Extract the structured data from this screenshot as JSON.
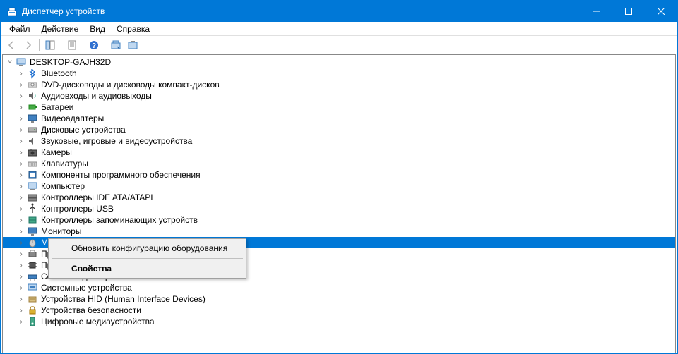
{
  "window": {
    "title": "Диспетчер устройств"
  },
  "menu": {
    "file": "Файл",
    "action": "Действие",
    "view": "Вид",
    "help": "Справка"
  },
  "tree": {
    "root": "DESKTOP-GAJH32D",
    "items": [
      "Bluetooth",
      "DVD-дисководы и дисководы компакт-дисков",
      "Аудиовходы и аудиовыходы",
      "Батареи",
      "Видеоадаптеры",
      "Дисковые устройства",
      "Звуковые, игровые и видеоустройства",
      "Камеры",
      "Клавиатуры",
      "Компоненты программного обеспечения",
      "Компьютер",
      "Контроллеры IDE ATA/ATAPI",
      "Контроллеры USB",
      "Контроллеры запоминающих устройств",
      "Мониторы",
      "Мы",
      "Пр",
      "Пр",
      "Сетевые адаптеры",
      "Системные устройства",
      "Устройства HID (Human Interface Devices)",
      "Устройства безопасности",
      "Цифровые медиаустройства"
    ]
  },
  "context_menu": {
    "refresh": "Обновить конфигурацию оборудования",
    "properties": "Свойства"
  }
}
